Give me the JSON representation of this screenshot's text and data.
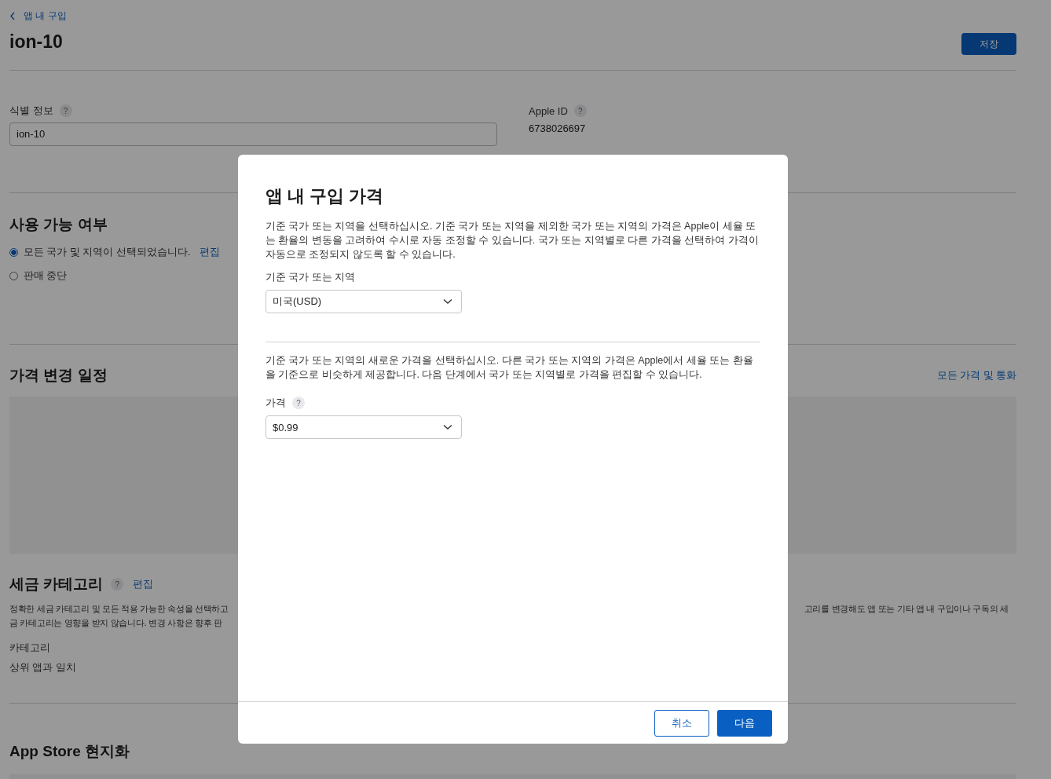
{
  "breadcrumb": {
    "label": "앱 내 구입"
  },
  "page_title": "ion-10",
  "save_button": "저장",
  "identity": {
    "label": "식별 정보",
    "help": "?",
    "value": "ion-10"
  },
  "apple_id": {
    "label": "Apple ID",
    "help": "?",
    "value": "6738026697"
  },
  "availability": {
    "title": "사용 가능 여부",
    "options": [
      {
        "label": "모든 국가 및 지역이 선택되었습니다.",
        "selected": true,
        "link": "편집"
      },
      {
        "label": "판매 중단",
        "selected": false
      }
    ]
  },
  "price_schedule": {
    "title": "가격 변경 일정",
    "link": "모든 가격 및 통화"
  },
  "tax": {
    "title": "세금 카테고리",
    "help": "?",
    "link": "편집",
    "description_left": [
      "정확한 세금 카테고리 및 모든 적용 가능한 속성을 선택하고",
      "금 카테고리는 영향을 받지 않습니다. 변경 사항은 향후 판"
    ],
    "description_right": [
      "고리를 변경해도 앱 또는 기타 앱 내 구입이나 구독의 세"
    ],
    "category_label": "카테고리",
    "category_value": "상위 앱과 일치"
  },
  "localization": {
    "title": "App Store 현지화"
  },
  "dialog": {
    "title": "앱 내 구입 가격",
    "intro": "기준 국가 또는 지역을 선택하십시오. 기준 국가 또는 지역을 제외한 국가 또는 지역의 가격은 Apple이 세율 또는 환율의 변동을 고려하여 수시로 자동 조정할 수 있습니다. 국가 또는 지역별로 다른 가격을 선택하여 가격이 자동으로 조정되지 않도록 할 수 있습니다.",
    "region_label": "기준 국가 또는 지역",
    "region_value": "미국(USD)",
    "price_intro": "기준 국가 또는 지역의 새로운 가격을 선택하십시오. 다른 국가 또는 지역의 가격은 Apple에서 세율 또는 환율을 기준으로 비슷하게 제공합니다. 다음 단계에서 국가 또는 지역별로 가격을 편집할 수 있습니다.",
    "price_label": "가격",
    "price_help": "?",
    "price_value": "$0.99",
    "cancel_button": "취소",
    "next_button": "다음"
  }
}
